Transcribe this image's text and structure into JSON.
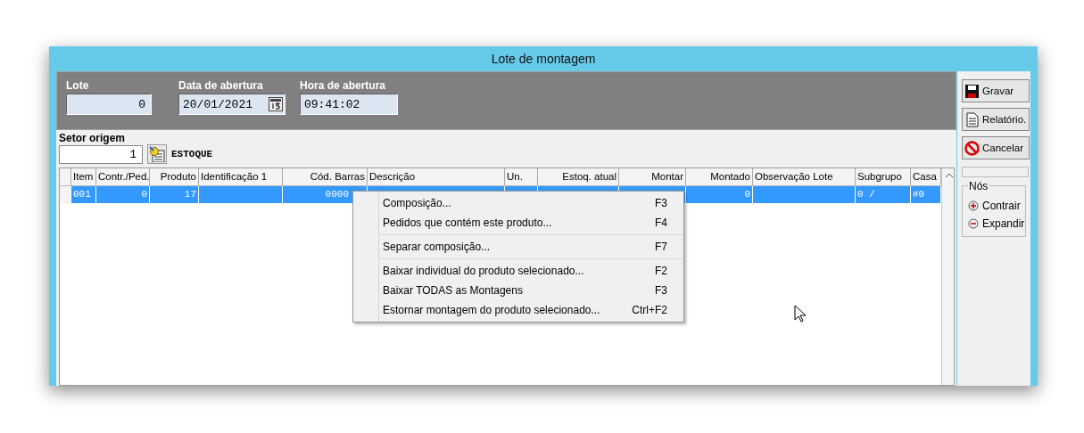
{
  "window": {
    "title": "Lote de montagem"
  },
  "header": {
    "fields": [
      {
        "label": "Lote",
        "value": "0",
        "kind": "number"
      },
      {
        "label": "Data de abertura",
        "value": "20/01/2021",
        "kind": "date"
      },
      {
        "label": "Hora de abertura",
        "value": "09:41:02",
        "kind": "text"
      }
    ]
  },
  "setor": {
    "label": "Setor origem",
    "value": "1",
    "name": "ESTOQUE"
  },
  "table": {
    "columns": [
      "Item",
      "Contr./Ped.",
      "Produto",
      "Identificação 1",
      "Cód. Barras",
      "Descrição",
      "Un.",
      "Estoq. atual",
      "Montar",
      "Montado",
      "Observação Lote",
      "Subgrupo",
      "Casa"
    ],
    "rows": [
      {
        "selected": true,
        "cells": [
          "001",
          "0",
          "17",
          "",
          "0000",
          "",
          "",
          "",
          "",
          "0",
          "",
          "0 /",
          "#0"
        ]
      }
    ]
  },
  "context_menu": {
    "groups": [
      [
        {
          "label": "Composição...",
          "shortcut": "F3"
        },
        {
          "label": "Pedidos que contém este produto...",
          "shortcut": "F4"
        }
      ],
      [
        {
          "label": "Separar composição...",
          "shortcut": "F7"
        }
      ],
      [
        {
          "label": "Baixar individual do produto selecionado...",
          "shortcut": "F2"
        },
        {
          "label": "Baixar TODAS as Montagens",
          "shortcut": "F3"
        },
        {
          "label": "Estornar montagem do produto selecionado...",
          "shortcut": "Ctrl+F2"
        }
      ]
    ]
  },
  "side": {
    "buttons": [
      {
        "label": "Gravar",
        "kind": "save"
      },
      {
        "label": "Relatório.",
        "kind": "report"
      },
      {
        "label": "Cancelar",
        "kind": "cancel"
      }
    ],
    "nodes": {
      "title": "Nós",
      "items": [
        {
          "label": "Contrair",
          "kind": "collapse"
        },
        {
          "label": "Expandir",
          "kind": "expand"
        }
      ]
    }
  }
}
